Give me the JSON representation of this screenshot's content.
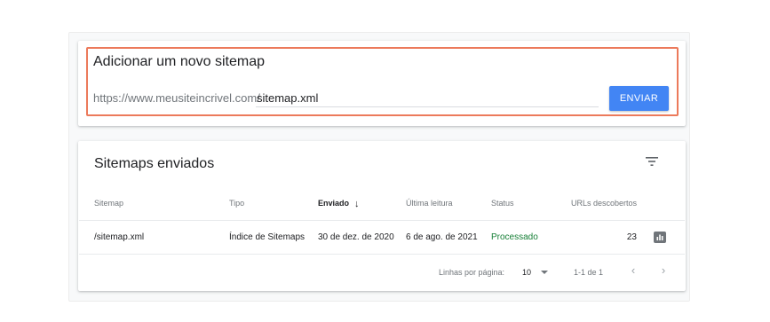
{
  "add_sitemap": {
    "title": "Adicionar um novo sitemap",
    "url_prefix": "https://www.meusiteincrivel.com/",
    "input_value": "sitemap.xml",
    "submit_label": "ENVIAR"
  },
  "submitted": {
    "title": "Sitemaps enviados",
    "columns": {
      "sitemap": "Sitemap",
      "type": "Tipo",
      "submitted": "Enviado",
      "last_read": "Última leitura",
      "status": "Status",
      "urls": "URLs descobertos"
    },
    "rows": [
      {
        "sitemap": "/sitemap.xml",
        "type": "Índice de Sitemaps",
        "submitted": "30 de dez. de 2020",
        "last_read": "6 de ago. de 2021",
        "status": "Processado",
        "urls": "23"
      }
    ],
    "footer": {
      "rows_per_page_label": "Linhas por página:",
      "rows_per_page_value": "10",
      "range": "1-1 de 1"
    }
  },
  "icons": {
    "filter": "filter-icon",
    "sort": "arrow-down-icon",
    "chart": "bar-chart-icon",
    "prev": "chevron-left-icon",
    "next": "chevron-right-icon"
  },
  "colors": {
    "accent": "#4285f4",
    "highlight": "#ec7a5b",
    "status_ok": "#188038"
  }
}
